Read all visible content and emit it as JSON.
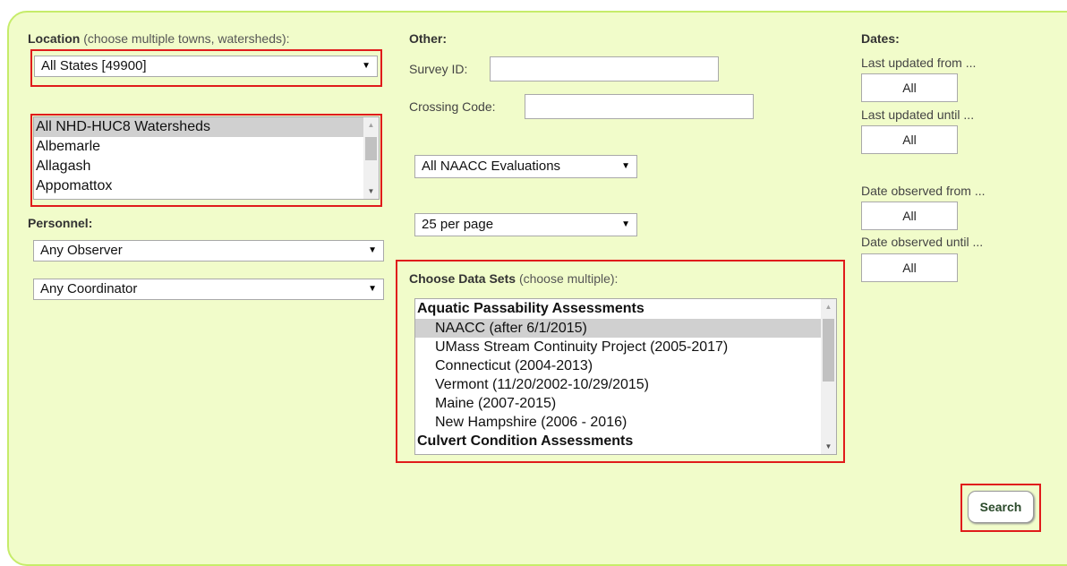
{
  "location": {
    "label": "Location",
    "hint": "(choose multiple towns, watersheds):",
    "states_select": "All States [49900]",
    "watersheds": [
      {
        "label": "All NHD-HUC8 Watersheds",
        "selected": true
      },
      {
        "label": "Albemarle",
        "selected": false
      },
      {
        "label": "Allagash",
        "selected": false
      },
      {
        "label": "Appomattox",
        "selected": false
      }
    ]
  },
  "personnel": {
    "label": "Personnel:",
    "observer_select": "Any Observer",
    "coordinator_select": "Any Coordinator"
  },
  "other": {
    "label": "Other:",
    "survey_id_label": "Survey ID:",
    "survey_id_value": "",
    "crossing_code_label": "Crossing Code:",
    "crossing_code_value": "",
    "evaluations_select": "All NAACC Evaluations",
    "per_page_select": "25 per page"
  },
  "datasets": {
    "label": "Choose Data Sets",
    "hint": "(choose multiple):",
    "groups": [
      {
        "name": "Aquatic Passability Assessments",
        "options": [
          {
            "label": "NAACC (after 6/1/2015)",
            "selected": true
          },
          {
            "label": "UMass Stream Continuity Project (2005-2017)",
            "selected": false
          },
          {
            "label": "Connecticut (2004-2013)",
            "selected": false
          },
          {
            "label": "Vermont (11/20/2002-10/29/2015)",
            "selected": false
          },
          {
            "label": "Maine (2007-2015)",
            "selected": false
          },
          {
            "label": "New Hampshire (2006 - 2016)",
            "selected": false
          }
        ]
      },
      {
        "name": "Culvert Condition Assessments",
        "options": []
      }
    ]
  },
  "dates": {
    "label": "Dates:",
    "updated_from_label": "Last updated from ...",
    "updated_from_value": "All",
    "updated_until_label": "Last updated until ...",
    "updated_until_value": "All",
    "observed_from_label": "Date observed from ...",
    "observed_from_value": "All",
    "observed_until_label": "Date observed until ...",
    "observed_until_value": "All"
  },
  "search_button": "Search",
  "colors": {
    "panel_bg": "#f1fcca",
    "panel_border": "#c6ec6a",
    "highlight_border": "#e01b1b"
  }
}
